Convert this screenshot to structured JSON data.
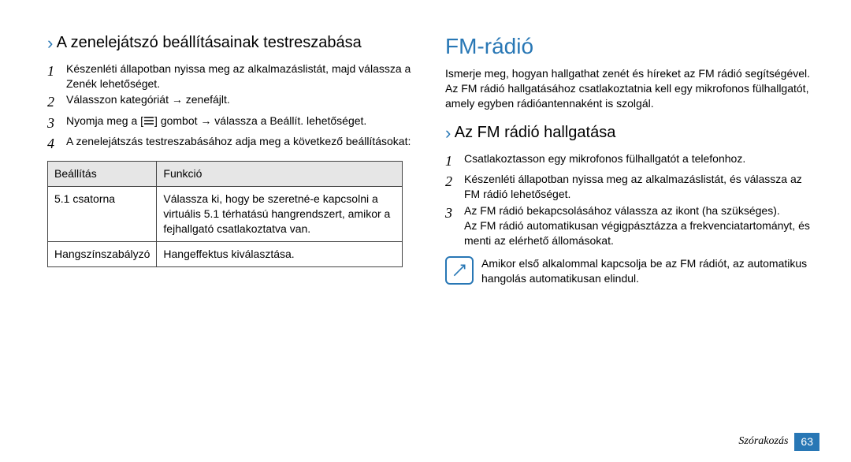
{
  "left": {
    "heading": "A zenelejátszó beállításainak testreszabása",
    "steps": [
      "Készenléti állapotban nyissa meg az alkalmazáslistát, majd válassza a Zenék lehetőséget.",
      "Válasszon kategóriát → zenefájlt.",
      "Nyomja meg a [ ≡ ] gombot → válassza a Beállít. lehetőséget.",
      "A zenelejátszás testreszabásához adja meg a következő beállításokat:"
    ],
    "table": {
      "head": [
        "Beállítás",
        "Funkció"
      ],
      "rows": [
        [
          "5.1 csatorna",
          "Válassza ki, hogy be szeretné-e kapcsolni a virtuális 5.1 térhatású hangrendszert, amikor a fejhallgató csatlakoztatva van."
        ],
        [
          "Hangszínszabályzó",
          "Hangeffektus kiválasztása."
        ]
      ]
    }
  },
  "right": {
    "title": "FM-rádió",
    "intro": "Ismerje meg, hogyan hallgathat zenét és híreket az FM rádió segítségével. Az FM rádió hallgatásához csatlakoztatnia kell egy mikrofonos fülhallgatót, amely egyben rádióantennaként is szolgál.",
    "subheading": "Az FM rádió hallgatása",
    "steps": [
      "Csatlakoztasson egy mikrofonos fülhallgatót a telefonhoz.",
      "Készenléti állapotban nyissa meg az alkalmazáslistát, és válassza az FM rádió lehetőséget.",
      "Az FM rádió bekapcsolásához válassza az ikont (ha szükséges).\nAz FM rádió automatikusan végigpásztázza a frekvenciatartományt, és menti az elérhető állomásokat."
    ],
    "note": "Amikor első alkalommal kapcsolja be az FM rádiót, az automatikus hangolás automatikusan elindul."
  },
  "footer": {
    "section": "Szórakozás",
    "page": "63"
  }
}
